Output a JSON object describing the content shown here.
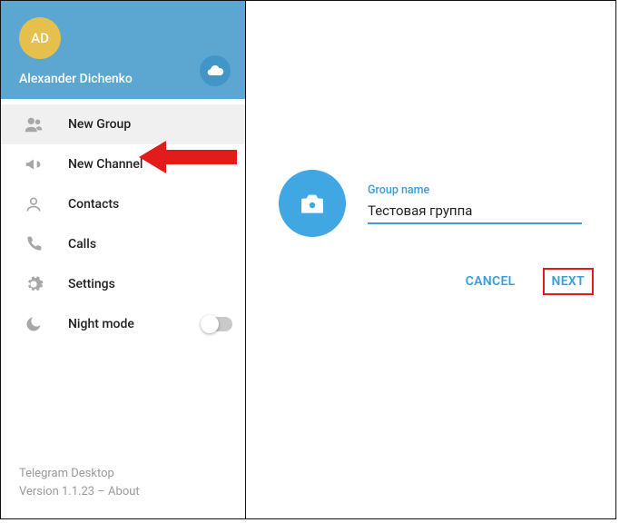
{
  "sidebar": {
    "avatar_initials": "AD",
    "username": "Alexander Dichenko",
    "items": [
      {
        "label": "New Group"
      },
      {
        "label": "New Channel"
      },
      {
        "label": "Contacts"
      },
      {
        "label": "Calls"
      },
      {
        "label": "Settings"
      },
      {
        "label": "Night mode"
      }
    ],
    "footer_app": "Telegram Desktop",
    "footer_version": "Version 1.1.23 – About"
  },
  "dialog": {
    "field_label": "Group name",
    "group_name_value": "Тестовая группа",
    "cancel_label": "CANCEL",
    "next_label": "NEXT"
  },
  "colors": {
    "accent": "#3a9eda",
    "header_bg": "#5ba7d1",
    "avatar_bg": "#e5c04c",
    "annotation_red": "#e21b1b"
  }
}
